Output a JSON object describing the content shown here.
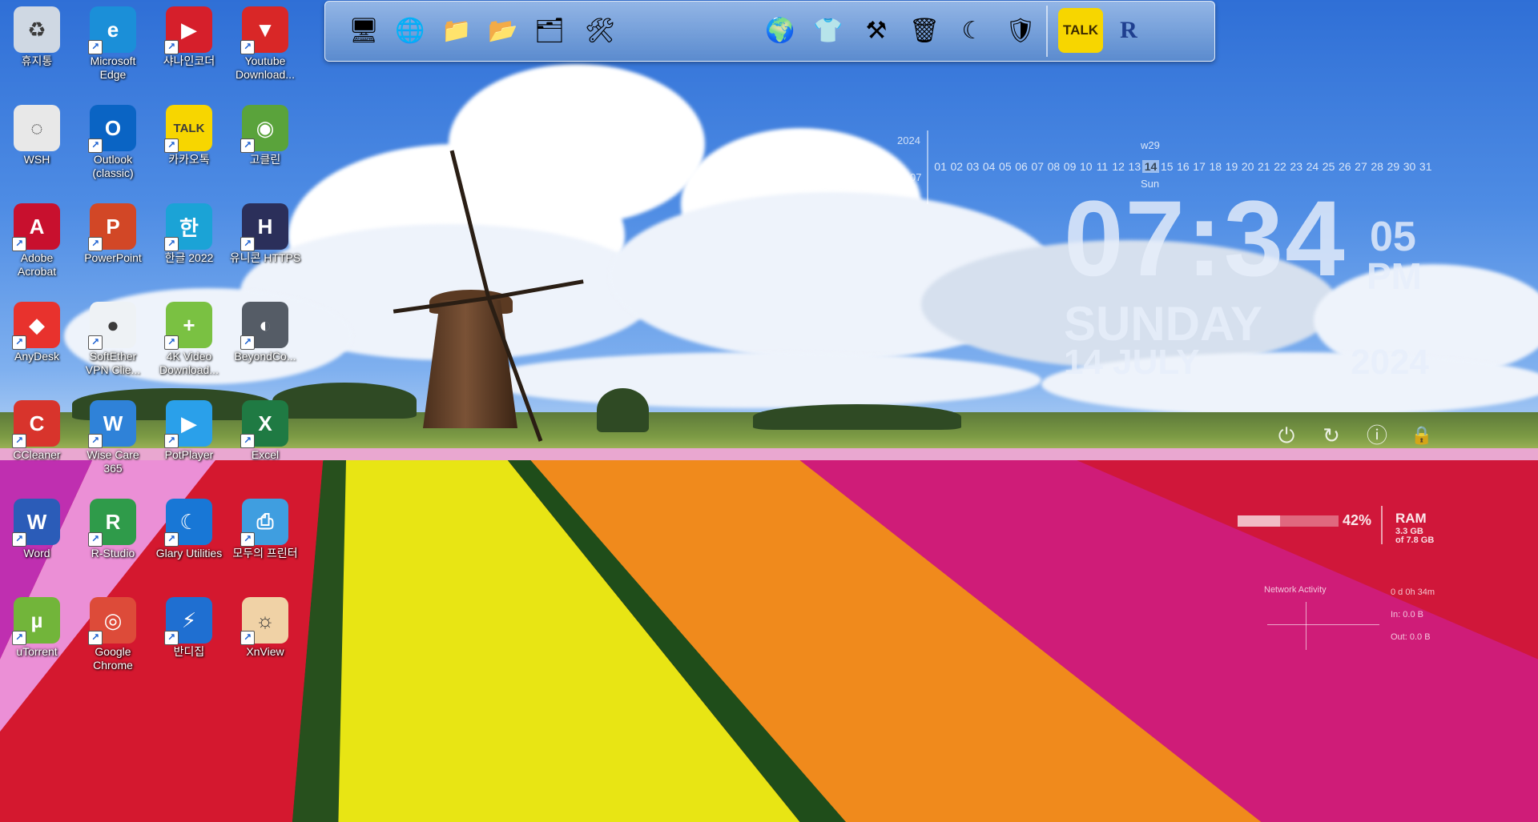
{
  "desktop_icons": [
    {
      "label": "휴지통",
      "icon": "recycle-bin-icon",
      "color": "#cfd8e3",
      "glyph": "♻",
      "shortcut": false
    },
    {
      "label": "Microsoft Edge",
      "icon": "edge-icon",
      "color": "#1b8fd8",
      "glyph": "e",
      "shortcut": true
    },
    {
      "label": "샤나인코더",
      "icon": "shana-encoder-icon",
      "color": "#d61f2b",
      "glyph": "▶",
      "shortcut": true
    },
    {
      "label": "Youtube Download...",
      "icon": "youtube-downloader-icon",
      "color": "#d92727",
      "glyph": "▼",
      "shortcut": true
    },
    {
      "label": "WSH",
      "icon": "wsh-file-icon",
      "color": "#e8e8e8",
      "glyph": "◌",
      "shortcut": false
    },
    {
      "label": "Outlook (classic)",
      "icon": "outlook-icon",
      "color": "#0a64c4",
      "glyph": "O",
      "shortcut": true
    },
    {
      "label": "카카오톡",
      "icon": "kakaotalk-icon",
      "color": "#f7d600",
      "glyph": "TALK",
      "shortcut": true
    },
    {
      "label": "고클린",
      "icon": "goclean-icon",
      "color": "#5aa33b",
      "glyph": "◉",
      "shortcut": true
    },
    {
      "label": "Adobe Acrobat",
      "icon": "acrobat-icon",
      "color": "#c8102e",
      "glyph": "A",
      "shortcut": true
    },
    {
      "label": "PowerPoint",
      "icon": "powerpoint-icon",
      "color": "#d24726",
      "glyph": "P",
      "shortcut": true
    },
    {
      "label": "한글 2022",
      "icon": "hangul-icon",
      "color": "#1ba3d6",
      "glyph": "한",
      "shortcut": true
    },
    {
      "label": "유니콘 HTTPS",
      "icon": "unicorn-https-icon",
      "color": "#2b2f5a",
      "glyph": "H",
      "shortcut": true
    },
    {
      "label": "AnyDesk",
      "icon": "anydesk-icon",
      "color": "#e8322d",
      "glyph": "◆",
      "shortcut": true
    },
    {
      "label": "SoftEther VPN Clie...",
      "icon": "softether-vpn-icon",
      "color": "#eef2f5",
      "glyph": "●",
      "shortcut": true
    },
    {
      "label": "4K Video Download...",
      "icon": "4k-video-downloader-icon",
      "color": "#7ac142",
      "glyph": "+",
      "shortcut": true
    },
    {
      "label": "BeyondCo...",
      "icon": "beyond-compare-icon",
      "color": "#555c66",
      "glyph": "◐",
      "shortcut": true
    },
    {
      "label": "CCleaner",
      "icon": "ccleaner-icon",
      "color": "#d8342c",
      "glyph": "C",
      "shortcut": true
    },
    {
      "label": "Wise Care 365",
      "icon": "wise-care-icon",
      "color": "#2f82d8",
      "glyph": "W",
      "shortcut": true
    },
    {
      "label": "PotPlayer",
      "icon": "potplayer-icon",
      "color": "#2aa0ea",
      "glyph": "▶",
      "shortcut": true
    },
    {
      "label": "Excel",
      "icon": "excel-icon",
      "color": "#1f7a43",
      "glyph": "X",
      "shortcut": true
    },
    {
      "label": "Word",
      "icon": "word-icon",
      "color": "#2b5cb8",
      "glyph": "W",
      "shortcut": true
    },
    {
      "label": "R-Studio",
      "icon": "r-studio-icon",
      "color": "#2f9b4a",
      "glyph": "R",
      "shortcut": true
    },
    {
      "label": "Glary Utilities",
      "icon": "glary-utilities-icon",
      "color": "#1877d6",
      "glyph": "☾",
      "shortcut": true
    },
    {
      "label": "모두의 프린터",
      "icon": "everyones-printer-icon",
      "color": "#3f9ee0",
      "glyph": "⎙",
      "shortcut": true
    },
    {
      "label": "uTorrent",
      "icon": "utorrent-icon",
      "color": "#72b53a",
      "glyph": "µ",
      "shortcut": true
    },
    {
      "label": "Google Chrome",
      "icon": "chrome-icon",
      "color": "#dd4b39",
      "glyph": "◎",
      "shortcut": true
    },
    {
      "label": "반디집",
      "icon": "bandizip-icon",
      "color": "#1f6fd1",
      "glyph": "⚡",
      "shortcut": true
    },
    {
      "label": "XnView",
      "icon": "xnview-icon",
      "color": "#f0d2a6",
      "glyph": "☼",
      "shortcut": true
    }
  ],
  "dock_items": [
    {
      "icon": "computer-icon",
      "glyph": "🖥"
    },
    {
      "icon": "network-globe-icon",
      "glyph": "🌐"
    },
    {
      "icon": "folder-icon",
      "glyph": "📁"
    },
    {
      "icon": "folder-documents-icon",
      "glyph": "📂"
    },
    {
      "icon": "folder-pictures-icon",
      "glyph": "🗂"
    },
    {
      "icon": "tools-icon",
      "glyph": "🛠"
    },
    {
      "icon": "internet-globe-icon",
      "glyph": "🌍"
    },
    {
      "icon": "tshirt-icon",
      "glyph": "👕"
    },
    {
      "icon": "hammer-tools-icon",
      "glyph": "⚒"
    },
    {
      "icon": "recycle-bin-icon",
      "glyph": "🗑"
    },
    {
      "icon": "glary-utilities-icon",
      "glyph": "☾"
    },
    {
      "icon": "wise-care-icon",
      "glyph": "🛡"
    },
    {
      "icon": "kakaotalk-icon",
      "glyph": "TALK"
    },
    {
      "icon": "r-studio-icon",
      "glyph": "R"
    }
  ],
  "calendar": {
    "year": "2024",
    "month": "07",
    "week": "w29",
    "weekday": "Sun",
    "days": [
      "01",
      "02",
      "03",
      "04",
      "05",
      "06",
      "07",
      "08",
      "09",
      "10",
      "11",
      "12",
      "13",
      "14",
      "15",
      "16",
      "17",
      "18",
      "19",
      "20",
      "21",
      "22",
      "23",
      "24",
      "25",
      "26",
      "27",
      "28",
      "29",
      "30",
      "31"
    ],
    "today": "14"
  },
  "clock": {
    "time": "07:34",
    "seconds": "05",
    "ampm": "PM",
    "day": "SUNDAY",
    "date": "14 JULY",
    "year": "2024"
  },
  "power_buttons": [
    {
      "name": "shutdown-icon",
      "glyph": "⏻"
    },
    {
      "name": "restart-icon",
      "glyph": "↻"
    },
    {
      "name": "logoff-icon",
      "glyph": "ⓘ"
    },
    {
      "name": "lock-icon",
      "glyph": "🔒"
    }
  ],
  "ram": {
    "title": "RAM",
    "percent": 42,
    "percent_label": "42%",
    "used": "3.3 GB",
    "total": "of 7.8 GB"
  },
  "network": {
    "title": "Network Activity",
    "uptime": "0 d 0h 34m",
    "in": "In: 0.0 B",
    "out": "Out: 0.0 B"
  },
  "colors": {
    "sky_top": "#2f6fd6",
    "tulip_red": "#d01a35",
    "tulip_pink": "#e03fa8",
    "tulip_yellow": "#f1ea12",
    "tulip_orange": "#f08a1c",
    "tulip_magenta": "#c81c6e"
  }
}
